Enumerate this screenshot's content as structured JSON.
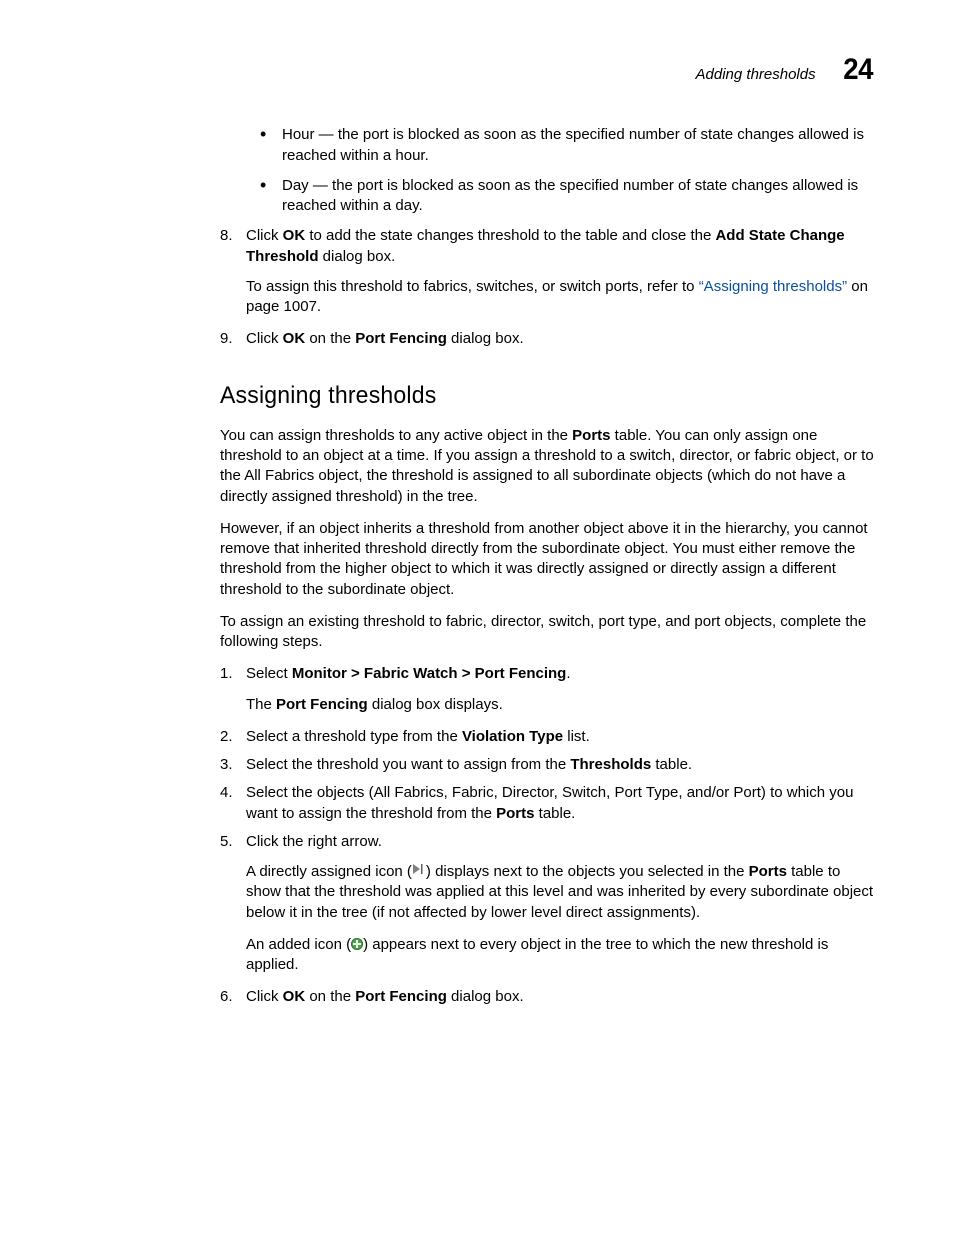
{
  "header": {
    "running_title": "Adding thresholds",
    "chapter_number": "24"
  },
  "top_bullets": [
    {
      "term": "Hour",
      "rest": " — the port is blocked as soon as the specified number of state changes allowed is reached within a hour."
    },
    {
      "term": "Day",
      "rest": " — the port is blocked as soon as the specified number of state changes allowed is reached within a day."
    }
  ],
  "step8": {
    "num": "8.",
    "pre1": "Click ",
    "ok": "OK",
    "mid1": " to add the state changes threshold to the table and close the ",
    "bold2": "Add State Change Threshold",
    "post1": " dialog box.",
    "sub_pre": "To assign this threshold to fabrics, switches, or switch ports, refer to ",
    "sub_link": "“Assigning thresholds”",
    "sub_post": " on page 1007."
  },
  "step9": {
    "num": "9.",
    "pre": "Click ",
    "ok": "OK",
    "mid": " on the ",
    "pf": "Port Fencing",
    "post": " dialog box."
  },
  "section_heading": "Assigning thresholds",
  "p1": {
    "a": "You can assign thresholds to any active object in the ",
    "b": "Ports",
    "c": " table. You can only assign one threshold to an object at a time. If you assign a threshold to a switch, director, or fabric object, or to the All Fabrics object, the threshold is assigned to all subordinate objects (which do not have a directly assigned threshold) in the tree."
  },
  "p2": "However, if an object inherits a threshold from another object above it in the hierarchy, you cannot remove that inherited threshold directly from the subordinate object. You must either remove the threshold from the higher object to which it was directly assigned or directly assign a different threshold to the subordinate object.",
  "p3": "To assign an existing threshold to fabric, director, switch, port type, and port objects, complete the following steps.",
  "steps": {
    "s1": {
      "num": "1.",
      "a": "Select ",
      "b": "Monitor > Fabric Watch > Port Fencing",
      "c": ".",
      "sub_a": "The ",
      "sub_b": "Port Fencing",
      "sub_c": " dialog box displays."
    },
    "s2": {
      "num": "2.",
      "a": "Select a threshold type from the ",
      "b": "Violation Type",
      "c": " list."
    },
    "s3": {
      "num": "3.",
      "a": "Select the threshold you want to assign from the ",
      "b": "Thresholds",
      "c": " table."
    },
    "s4": {
      "num": "4.",
      "a": "Select the objects (All Fabrics, Fabric, Director, Switch, Port Type, and/or Port) to which you want to assign the threshold from the ",
      "b": "Ports",
      "c": " table."
    },
    "s5": {
      "num": "5.",
      "a": "Click the right arrow.",
      "sub1_a": "A directly assigned icon (",
      "sub1_b": ") displays next to the objects you selected in the ",
      "sub1_c": "Ports",
      "sub1_d": " table to show that the threshold was applied at this level and was inherited by every subordinate object below it in the tree (if not affected by lower level direct assignments).",
      "sub2_a": "An added icon (",
      "sub2_b": ") appears next to every object in the tree to which the new threshold is applied."
    },
    "s6": {
      "num": "6.",
      "a": "Click ",
      "b": "OK",
      "c": " on the ",
      "d": "Port Fencing",
      "e": " dialog box."
    }
  }
}
